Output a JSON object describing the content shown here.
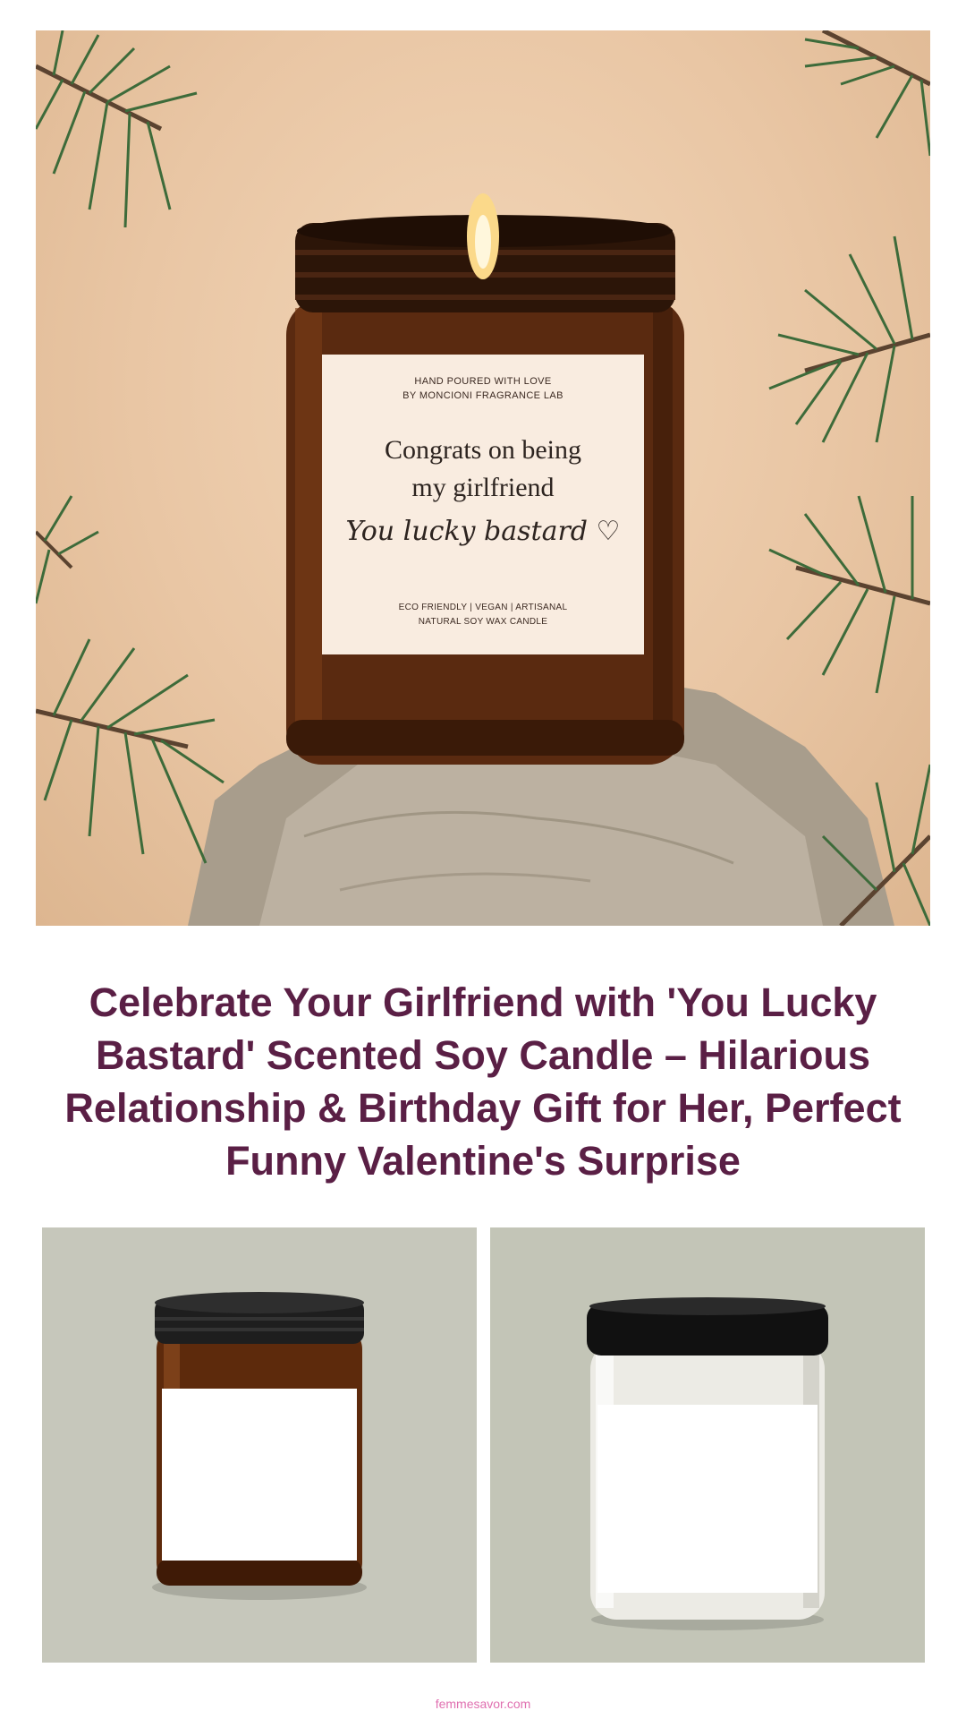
{
  "hero": {
    "candle_label": {
      "top_line_1": "HAND POURED WITH LOVE",
      "top_line_2": "BY MONCIONI FRAGRANCE LAB",
      "main_line_1": "Congrats on being",
      "main_line_2": "my girlfriend",
      "script": "You lucky bastard ♡",
      "bottom_line_1": "ECO FRIENDLY  |  VEGAN  |  ARTISANAL",
      "bottom_line_2": "NATURAL SOY WAX CANDLE"
    }
  },
  "product": {
    "title": "Celebrate Your Girlfriend with 'You Lucky Bastard' Scented Soy Candle – Hilarious Relationship & Birthday Gift for Her, Perfect Funny Valentine's Surprise"
  },
  "variants": [
    {
      "name": "amber-jar"
    },
    {
      "name": "white-jar"
    }
  ],
  "footer": {
    "site": "femmesavor.com"
  },
  "colors": {
    "title": "#5a1f45",
    "footer": "#e070b0",
    "amber": "#5a2a10",
    "background_panel": "#c7c8bc"
  }
}
